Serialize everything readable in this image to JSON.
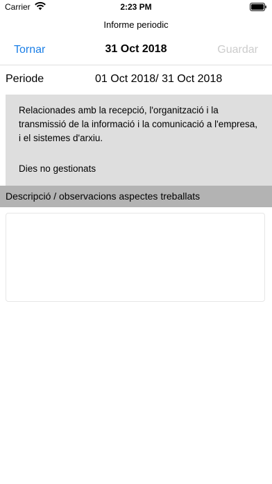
{
  "status_bar": {
    "carrier": "Carrier",
    "time": "2:23 PM",
    "wifi_icon": "wifi-icon",
    "battery_icon": "battery-icon"
  },
  "nav": {
    "subtitle": "Informe periodic",
    "back_label": "Tornar",
    "title": "31 Oct 2018",
    "save_label": "Guardar",
    "accent_color": "#1a7ee6",
    "disabled_color": "#cccccc"
  },
  "period": {
    "label": "Periode",
    "value": "01 Oct 2018/ 31 Oct 2018"
  },
  "info": {
    "description": "Relacionades amb la recepció, l'organització i la transmissió de la informació i la comunicació a l'empresa, i el sistemes d'arxiu.",
    "days_label": "Dies no gestionats"
  },
  "observations": {
    "header": "Descripció / observacions aspectes treballats",
    "value": ""
  }
}
